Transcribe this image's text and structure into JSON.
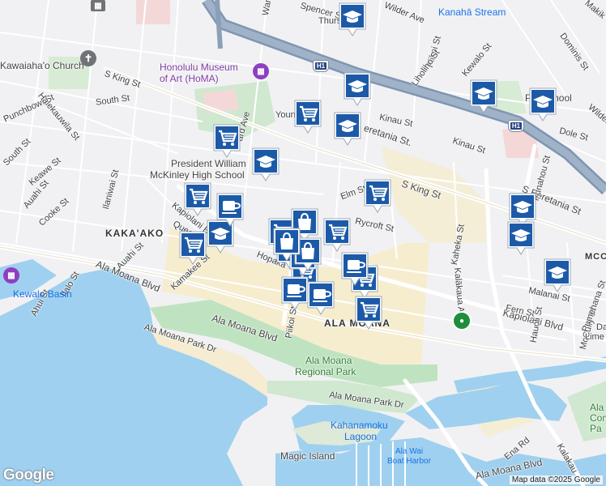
{
  "map": {
    "areas": {
      "kakaako": "KAKA'AKO",
      "ala_moana": "ALA MOANA",
      "mccully": "MCC - MC"
    },
    "streets": {
      "ward_ave": "Ward Ave",
      "spencer_st": "Spencer St",
      "thurston": "Thurs",
      "wilder_ave": "Wilder Ave",
      "wilder_ave_2": "Wilder Av",
      "piikoi_st_top": "Piikoi St",
      "kewalo_st": "Kewalo St",
      "liholiho_st": "Liholiho St",
      "dominis_st": "Dominis St",
      "makiki": "Makik",
      "s_king_st_west": "S King St",
      "s_king_st_east": "S King St",
      "south_st": "South St",
      "punchbowl_st": "Punchbowl St",
      "halekauwila_st": "Halekauwila St",
      "south_st_2": "South St",
      "keawe_st": "Keawe St",
      "auahi_st_west": "Auahi St",
      "cooke_st": "Cooke St",
      "ilaniwai_st": "Ilaniwai St",
      "young": "Youn",
      "ward_ave_2": "ard Ave",
      "kinau_st": "Kinau St",
      "kinau_st_2": "Kinau St",
      "beretania_st": "eretania St.",
      "s_beretania_st": "S Beretania St",
      "dole_st": "Dole St",
      "punahou_st": "Punahou St",
      "elm_st": "Elm St",
      "rycroft_st": "Rycroft St",
      "kaheka_st": "Kaheka St",
      "kapiolani_blvd_west": "Kapiolani Blvd",
      "kapiolani_blvd_east": "Kapiolani Blvd",
      "auahi_st": "Auahi St",
      "queen": "Queen",
      "hopaka": "Hopaka",
      "kamakee_st": "Kamakee St",
      "ilalo_st": "Ilalo St",
      "ahui_st": "Ahui St",
      "ala_moana_blvd_west": "Ala Moana Blvd",
      "ala_moana_blvd_mid": "Ala Moana Blvd",
      "ala_moana_blvd_east": "Ala Moana Blvd",
      "ala_moana_park_dr": "Ala Moana Park Dr",
      "ala_moana_park_dr_2": "Ala Moana Park Dr",
      "piikoi_st": "Piikoi St",
      "kalakaua_ave": "Kalākaua Ave",
      "kalakaua_ave_2": "Kalākaua",
      "malanai_st": "Malanai St",
      "fern_st": "Fern St",
      "hauoli_st": "Hauoli St",
      "mccully_st": "McCully St",
      "pumehana_st": "Pumehana St",
      "lime": "Lime",
      "da": "Da",
      "ena_rd": "Ena Rd",
      "kalakaua_east": "Kalakau"
    },
    "places": {
      "kawaiahao_church": "Kawaiaha'o Church",
      "homa_line1": "Honolulu Museum",
      "homa_line2": "of Art (HoMA)",
      "kanaha_stream": "Kanahā Stream",
      "mckinley_line1": "President William",
      "mckinley_line2": "McKinley High School",
      "kewalo_basin": "Kewalo Basin",
      "ala_moana_park_line1": "Ala Moana",
      "ala_moana_park_line2": "Regional Park",
      "kahanamoku_line1": "Kahanamoku",
      "kahanamoku_line2": "Lagoon",
      "ala_wai_line1": "Ala Wai",
      "ala_wai_line2": "Boat Harbor",
      "magic_island": "Magic Island",
      "punahou_school": "P     u School",
      "ala_moana_comm": "Ala Com Pa"
    },
    "highway": {
      "label": "H1"
    },
    "attribution": "Map data ©2025 Google",
    "logo": "Google",
    "colors": {
      "water": "#a9d2f0",
      "park": "#c8e6c9",
      "marker": "#1c5aa8",
      "shopping": "#f5e9c4",
      "highway": "#8aa0b8"
    },
    "markers": [
      {
        "type": "school-icon"
      },
      {
        "type": "school-icon"
      },
      {
        "type": "school-icon"
      },
      {
        "type": "school-icon"
      },
      {
        "type": "school-icon"
      },
      {
        "type": "school-icon"
      },
      {
        "type": "school-icon"
      },
      {
        "type": "school-icon"
      },
      {
        "type": "school-icon"
      },
      {
        "type": "school-icon"
      },
      {
        "type": "cart-icon"
      },
      {
        "type": "cart-icon"
      },
      {
        "type": "cart-icon"
      },
      {
        "type": "cart-icon"
      },
      {
        "type": "cart-icon"
      },
      {
        "type": "cart-icon"
      },
      {
        "type": "cart-icon"
      },
      {
        "type": "cart-icon"
      },
      {
        "type": "cart-icon"
      },
      {
        "type": "cart-icon"
      },
      {
        "type": "cart-icon"
      },
      {
        "type": "cafe-icon"
      },
      {
        "type": "cafe-icon"
      },
      {
        "type": "cafe-icon"
      },
      {
        "type": "cafe-icon"
      },
      {
        "type": "cafe-icon"
      },
      {
        "type": "bag-icon"
      },
      {
        "type": "bag-icon"
      },
      {
        "type": "bag-icon"
      }
    ]
  }
}
